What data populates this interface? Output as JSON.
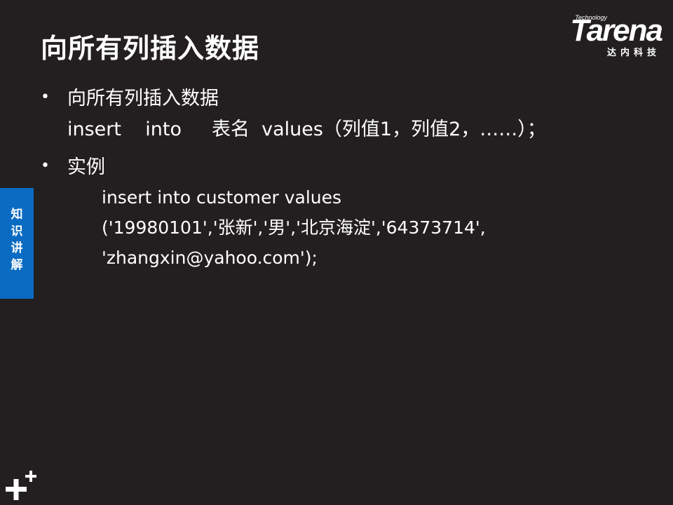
{
  "slide": {
    "title": "向所有列插入数据"
  },
  "logo": {
    "technology": "Technology",
    "word": "Tarena",
    "chinese": "达内科技"
  },
  "bullets": [
    {
      "marker": "•",
      "heading": "向所有列插入数据",
      "line": "insert    into     表名  values（列值1，列值2，……）；"
    },
    {
      "marker": "•",
      "heading": "实例",
      "code_lines": [
        "insert into customer values",
        "('19980101','张新','男','北京海淀','64373714',",
        "'zhangxin@yahoo.com');"
      ]
    }
  ],
  "side_tab": {
    "label": "知识讲解"
  },
  "colors": {
    "background": "#231f20",
    "text": "#ffffff",
    "side_tab": "#0a6bc2"
  }
}
